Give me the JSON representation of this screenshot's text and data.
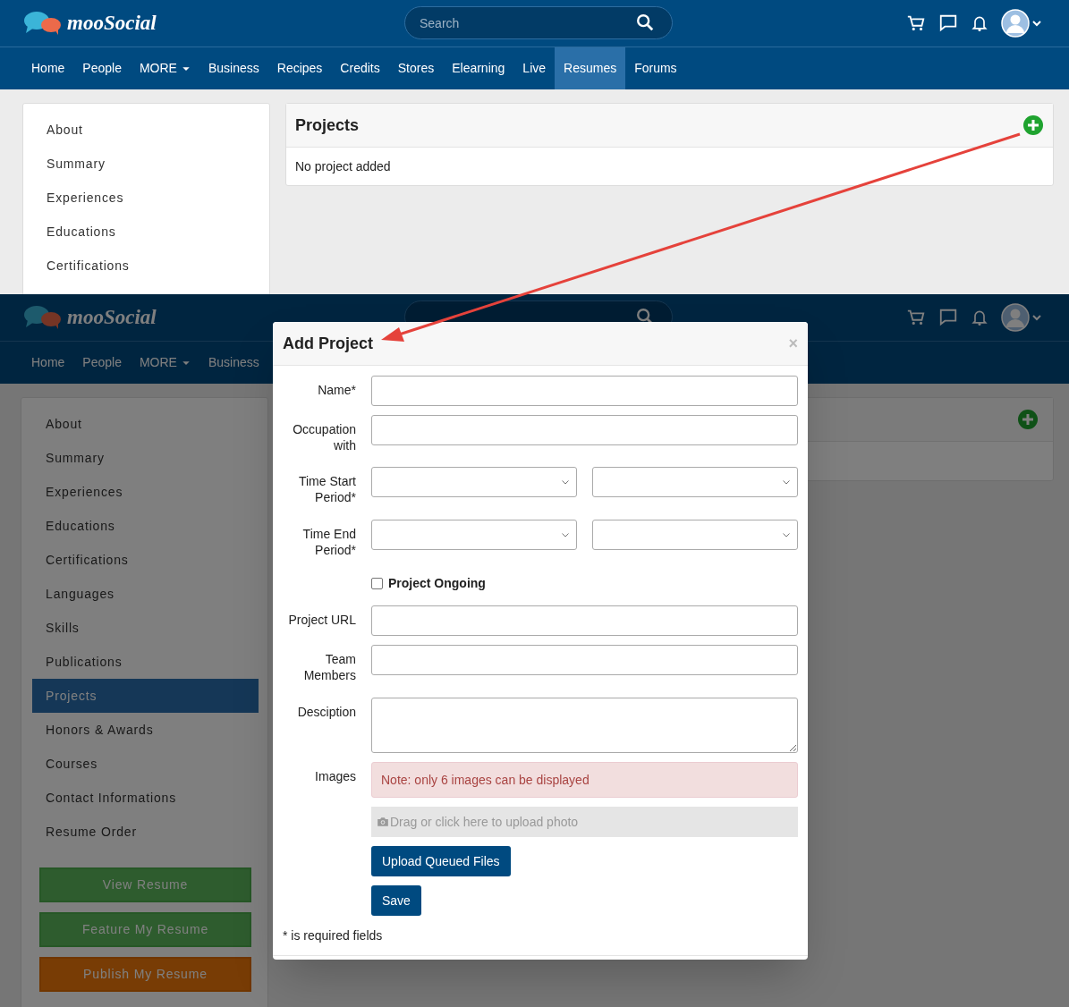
{
  "top_screen": {
    "header": {
      "logo": "mooSocial",
      "search": {
        "placeholder": "Search"
      }
    },
    "nav": [
      {
        "label": "Home",
        "kind": "link",
        "selected": false
      },
      {
        "label": "People",
        "kind": "link",
        "selected": false
      },
      {
        "label": "MORE",
        "kind": "dropdown",
        "selected": false
      },
      {
        "label": "Business",
        "kind": "link",
        "selected": false
      },
      {
        "label": "Recipes",
        "kind": "link",
        "selected": false
      },
      {
        "label": "Credits",
        "kind": "link",
        "selected": false
      },
      {
        "label": "Stores",
        "kind": "link",
        "selected": false
      },
      {
        "label": "Elearning",
        "kind": "link",
        "selected": false
      },
      {
        "label": "Live",
        "kind": "link",
        "selected": false
      },
      {
        "label": "Resumes",
        "kind": "link",
        "selected": true
      },
      {
        "label": "Forums",
        "kind": "link",
        "selected": false
      }
    ],
    "sidebar": {
      "items": [
        {
          "label": "About",
          "selected": false
        },
        {
          "label": "Summary",
          "selected": false
        },
        {
          "label": "Experiences",
          "selected": false
        },
        {
          "label": "Educations",
          "selected": false
        },
        {
          "label": "Certifications",
          "selected": false
        }
      ]
    },
    "projects_card": {
      "title": "Projects",
      "empty_text": "No project added"
    }
  },
  "bottom_screen": {
    "header": {
      "logo": "mooSocial"
    },
    "nav": [
      {
        "label": "Home",
        "kind": "link",
        "selected": false
      },
      {
        "label": "People",
        "kind": "link",
        "selected": false
      },
      {
        "label": "MORE",
        "kind": "dropdown",
        "selected": false
      },
      {
        "label": "Business",
        "kind": "link",
        "selected": false
      }
    ],
    "sidebar": {
      "items": [
        {
          "label": "About",
          "selected": false
        },
        {
          "label": "Summary",
          "selected": false
        },
        {
          "label": "Experiences",
          "selected": false
        },
        {
          "label": "Educations",
          "selected": false
        },
        {
          "label": "Certifications",
          "selected": false
        },
        {
          "label": "Languages",
          "selected": false
        },
        {
          "label": "Skills",
          "selected": false
        },
        {
          "label": "Publications",
          "selected": false
        },
        {
          "label": "Projects",
          "selected": true
        },
        {
          "label": "Honors & Awards",
          "selected": false
        },
        {
          "label": "Courses",
          "selected": false
        },
        {
          "label": "Contact Informations",
          "selected": false
        },
        {
          "label": "Resume Order",
          "selected": false
        }
      ],
      "buttons": [
        {
          "label": "View Resume",
          "kind": "success"
        },
        {
          "label": "Feature My Resume",
          "kind": "success"
        },
        {
          "label": "Publish My Resume",
          "kind": "warning"
        }
      ]
    }
  },
  "modal": {
    "title": "Add Project",
    "close": "×",
    "rows": [
      {
        "kind": "text",
        "label": "Name*"
      },
      {
        "kind": "text",
        "label": "Occupation with"
      },
      {
        "kind": "select_pair",
        "label": "Time Start Period*"
      },
      {
        "kind": "select_pair",
        "label": "Time End Period*"
      },
      {
        "kind": "checkbox",
        "text": "Project Ongoing",
        "checked": false
      },
      {
        "kind": "text",
        "label": "Project URL"
      },
      {
        "kind": "text",
        "label": "Team Members"
      },
      {
        "kind": "textarea",
        "label": "Desciption"
      },
      {
        "kind": "note",
        "label": "Images",
        "text": "Note: only 6 images can be displayed"
      },
      {
        "kind": "dropzone",
        "text": "Drag or click here to upload photo"
      },
      {
        "kind": "button",
        "text": "Upload Queued Files"
      },
      {
        "kind": "button",
        "text": "Save"
      }
    ],
    "footnote": "* is required fields"
  }
}
